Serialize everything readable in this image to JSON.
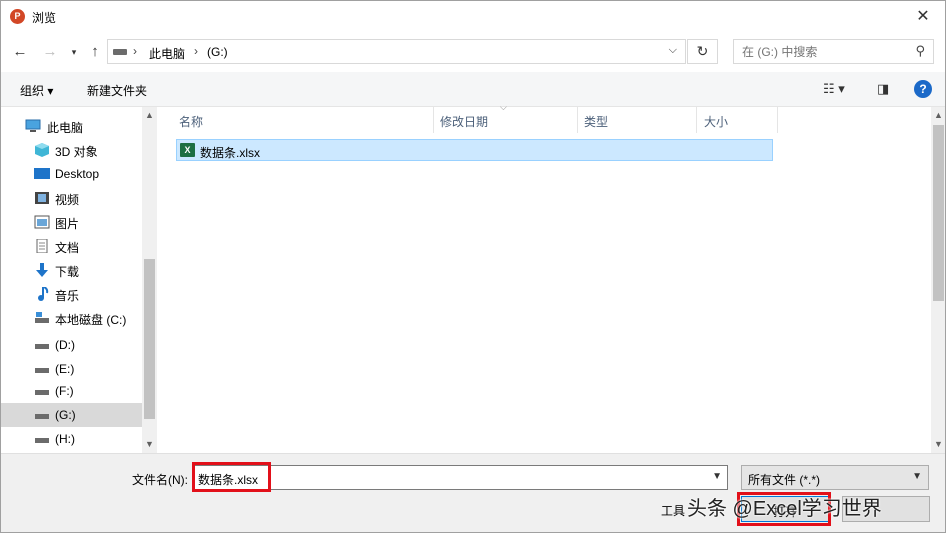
{
  "window": {
    "title": "浏览",
    "app_icon": "P"
  },
  "nav": {
    "breadcrumb": [
      "此电脑",
      "(G:)"
    ],
    "search_placeholder": "在 (G:) 中搜索"
  },
  "toolbar": {
    "organize": "组织 ▾",
    "new_folder": "新建文件夹"
  },
  "sidebar": {
    "items": [
      {
        "label": "此电脑",
        "icon": "computer-icon"
      },
      {
        "label": "3D 对象",
        "icon": "cube-icon"
      },
      {
        "label": "Desktop",
        "icon": "desktop-icon"
      },
      {
        "label": "视频",
        "icon": "video-icon"
      },
      {
        "label": "图片",
        "icon": "picture-icon"
      },
      {
        "label": "文档",
        "icon": "document-icon"
      },
      {
        "label": "下载",
        "icon": "download-icon"
      },
      {
        "label": "音乐",
        "icon": "music-icon"
      },
      {
        "label": "本地磁盘 (C:)",
        "icon": "drive-icon"
      },
      {
        "label": "(D:)",
        "icon": "drive-icon"
      },
      {
        "label": "(E:)",
        "icon": "drive-icon"
      },
      {
        "label": "(F:)",
        "icon": "drive-icon"
      },
      {
        "label": "(G:)",
        "icon": "drive-icon",
        "selected": true
      },
      {
        "label": "(H:)",
        "icon": "drive-icon"
      }
    ]
  },
  "columns": {
    "name": "名称",
    "date": "修改日期",
    "type": "类型",
    "size": "大小"
  },
  "files": [
    {
      "name": "数据条.xlsx",
      "icon": "excel-icon",
      "selected": true
    }
  ],
  "bottom": {
    "filename_label": "文件名(N):",
    "filename_value": "数据条.xlsx",
    "filetype": "所有文件 (*.*)",
    "tools": "工具",
    "open": "打开",
    "watermark": "头条 @Excel学习世界"
  },
  "colors": {
    "accent": "#0078d7",
    "selection": "#cce8ff",
    "highlight_box": "#e2101a"
  }
}
